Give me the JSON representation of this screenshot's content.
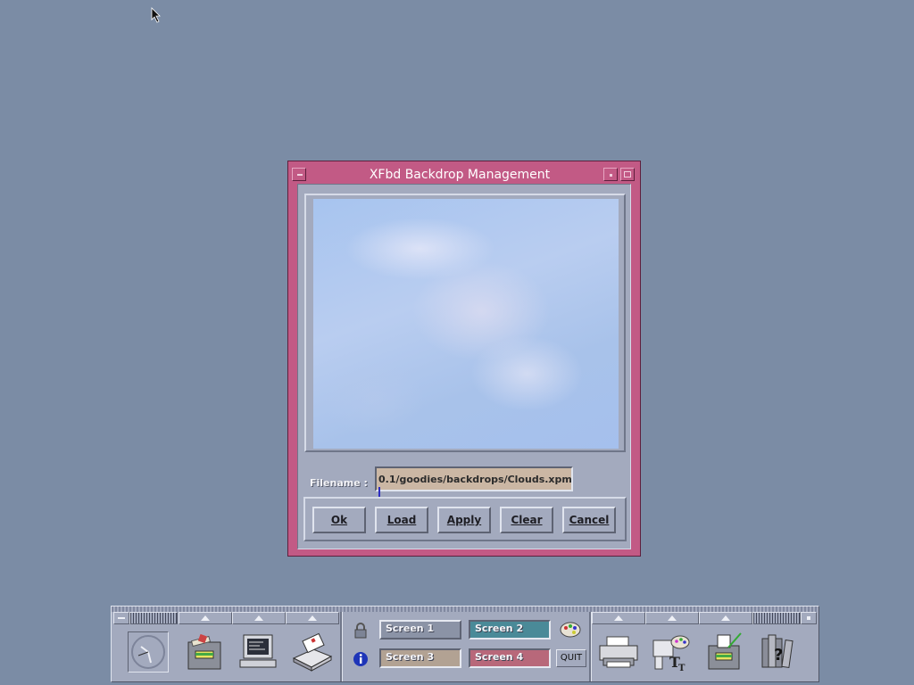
{
  "dialog": {
    "title": "XFbd Backdrop Management",
    "filename_label": "Filename :",
    "filename_value": "0.1/goodies/backdrops/Clouds.xpm",
    "buttons": [
      "Ok",
      "Load",
      "Apply",
      "Clear",
      "Cancel"
    ]
  },
  "panel": {
    "workspaces": [
      "Screen 1",
      "Screen 2",
      "Screen 3",
      "Screen 4"
    ],
    "quit_label": "QUIT",
    "icons": {
      "clock": "clock-icon",
      "files": "file-manager-icon",
      "terminal": "terminal-icon",
      "mail": "mail-icon",
      "lock": "lock-icon",
      "info": "info-icon",
      "palette": "palette-icon",
      "printer": "printer-icon",
      "fonts": "font-style-icon",
      "editor": "editor-icon",
      "help": "help-books-icon"
    }
  },
  "colors": {
    "desktop": "#7b8ca5",
    "window_frame": "#c25a85",
    "panel": "#a3aabe",
    "screen1": "#8b93a6",
    "screen2": "#4a8a98",
    "screen3": "#b2a293",
    "screen4": "#b8687a"
  }
}
